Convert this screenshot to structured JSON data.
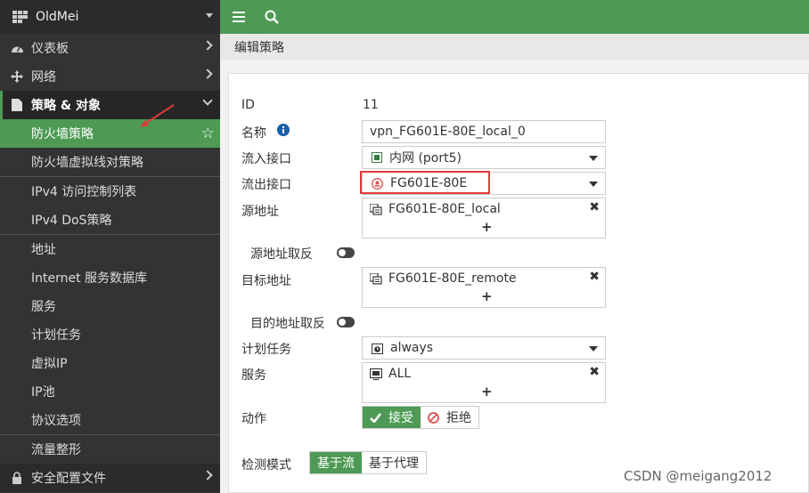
{
  "brand": {
    "name": "OldMei"
  },
  "sidebar": {
    "items": [
      {
        "label": "仪表板",
        "icon": "dashboard-icon"
      },
      {
        "label": "网络",
        "icon": "network-icon"
      },
      {
        "label": "策略 & 对象",
        "icon": "policy-icon"
      }
    ],
    "sub_items": [
      "防火墙策略",
      "防火墙虚拟线对策略",
      "IPv4 访问控制列表",
      "IPv4 DoS策略",
      "地址",
      "Internet 服务数据库",
      "服务",
      "计划任务",
      "虚拟IP",
      "IP池",
      "协议选项",
      "流量整形"
    ],
    "bottom_item": {
      "label": "安全配置文件",
      "icon": "security-profile-icon"
    }
  },
  "breadcrumb": {
    "title": "编辑策略"
  },
  "form": {
    "id_label": "ID",
    "id_value": "11",
    "name_label": "名称",
    "name_value": "vpn_FG601E-80E_local_0",
    "in_if_label": "流入接口",
    "in_if_value": "内网 (port5)",
    "out_if_label": "流出接口",
    "out_if_value": "FG601E-80E",
    "src_label": "源地址",
    "src_value": "FG601E-80E_local",
    "src_negate_label": "源地址取反",
    "dst_label": "目标地址",
    "dst_value": "FG601E-80E_remote",
    "dst_negate_label": "目的地址取反",
    "schedule_label": "计划任务",
    "schedule_value": "always",
    "service_label": "服务",
    "service_value": "ALL",
    "action_label": "动作",
    "action_accept": "接受",
    "action_deny": "拒绝",
    "inspect_label": "检测模式",
    "inspect_flow": "基于流",
    "inspect_proxy": "基于代理"
  },
  "watermark": "CSDN @meigang2012",
  "colors": {
    "accent": "#4e9a55",
    "sidebar": "#333333",
    "highlight": "#e03a3a"
  }
}
